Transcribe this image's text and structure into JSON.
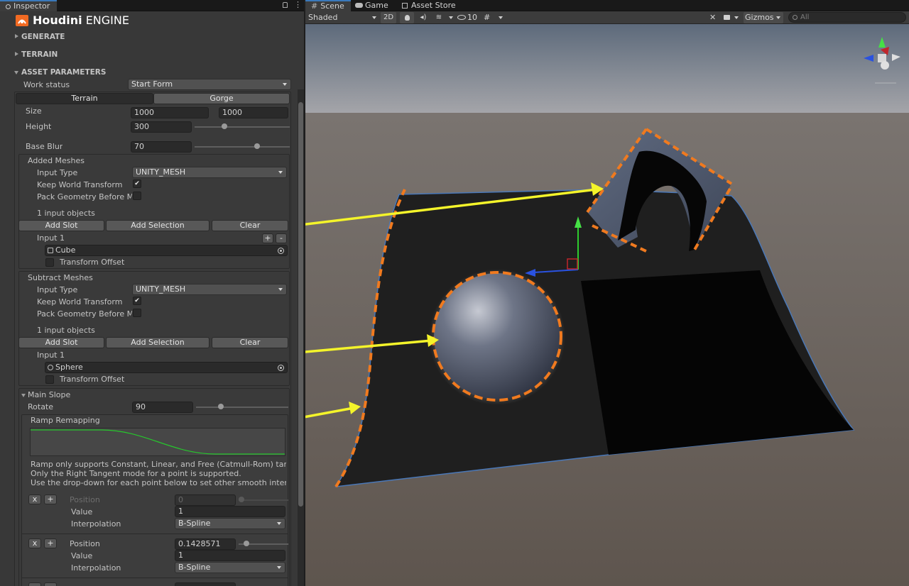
{
  "tabs": {
    "inspector": "Inspector",
    "scene": "Scene",
    "game": "Game",
    "asset_store": "Asset Store"
  },
  "header": {
    "logo_text_bold": "Houdini",
    "logo_text_light": "ENGINE"
  },
  "sections": {
    "generate": "GENERATE",
    "terrain": "TERRAIN",
    "asset_parameters": "ASSET PARAMETERS"
  },
  "work_status": {
    "label": "Work status",
    "value": "Start Form"
  },
  "mode_tabs": {
    "terrain": "Terrain",
    "gorge": "Gorge"
  },
  "size": {
    "label": "Size",
    "x": "1000",
    "y": "1000"
  },
  "height": {
    "label": "Height",
    "value": "300",
    "slider_fraction": 0.31
  },
  "base_blur": {
    "label": "Base Blur",
    "value": "70",
    "slider_fraction": 0.66
  },
  "added_meshes": {
    "title": "Added Meshes",
    "input_type_label": "Input Type",
    "input_type_value": "UNITY_MESH",
    "keep_world_label": "Keep World Transform",
    "keep_world_checked": "✔",
    "pack_geo_label": "Pack Geometry Before Merge",
    "objects_count": "1 input objects",
    "add_slot": "Add Slot",
    "add_selection": "Add Selection",
    "clear": "Clear",
    "input_label": "Input 1",
    "plus": "+",
    "minus": "-",
    "object": "Cube",
    "transform_offset": "Transform Offset"
  },
  "subtract_meshes": {
    "title": "Subtract Meshes",
    "input_type_label": "Input Type",
    "input_type_value": "UNITY_MESH",
    "keep_world_label": "Keep World Transform",
    "keep_world_checked": "✔",
    "pack_geo_label": "Pack Geometry Before Merge",
    "objects_count": "1 input objects",
    "add_slot": "Add Slot",
    "add_selection": "Add Selection",
    "clear": "Clear",
    "input_label": "Input 1",
    "object": "Sphere",
    "transform_offset": "Transform Offset"
  },
  "main_slope": {
    "title": "Main Slope",
    "rotate_label": "Rotate",
    "rotate_value": "90",
    "slider_fraction": 0.27,
    "ramp_title": "Ramp Remapping",
    "ramp_note_1": "Ramp only supports Constant, Linear, and Free (Catmull-Rom) tangent modes.",
    "ramp_note_2": "Only the Right Tangent mode for a point is supported.",
    "ramp_note_3": "Use the drop-down for each point below to set other smooth interpolation modes.",
    "points": [
      {
        "x": "x",
        "plus": "+",
        "position_label": "Position",
        "position": "0",
        "value_label": "Value",
        "value": "1",
        "interp_label": "Interpolation",
        "interp": "B-Spline"
      },
      {
        "x": "x",
        "plus": "+",
        "position_label": "Position",
        "position": "0.1428571",
        "value_label": "Value",
        "value": "1",
        "interp_label": "Interpolation",
        "interp": "B-Spline"
      }
    ]
  },
  "scene_toolbar": {
    "shading": "Shaded",
    "mode_2d": "2D",
    "hidden_count": "10",
    "gizmos": "Gizmos",
    "search_placeholder": "All"
  },
  "colors": {
    "panel": "#383838",
    "highlight_orange": "#f07a1f",
    "arrow_yellow": "#f4f42a",
    "terrain_dark": "#1c1c1c",
    "sky_top": "#5f6b7a",
    "ground": "#6a6058"
  }
}
